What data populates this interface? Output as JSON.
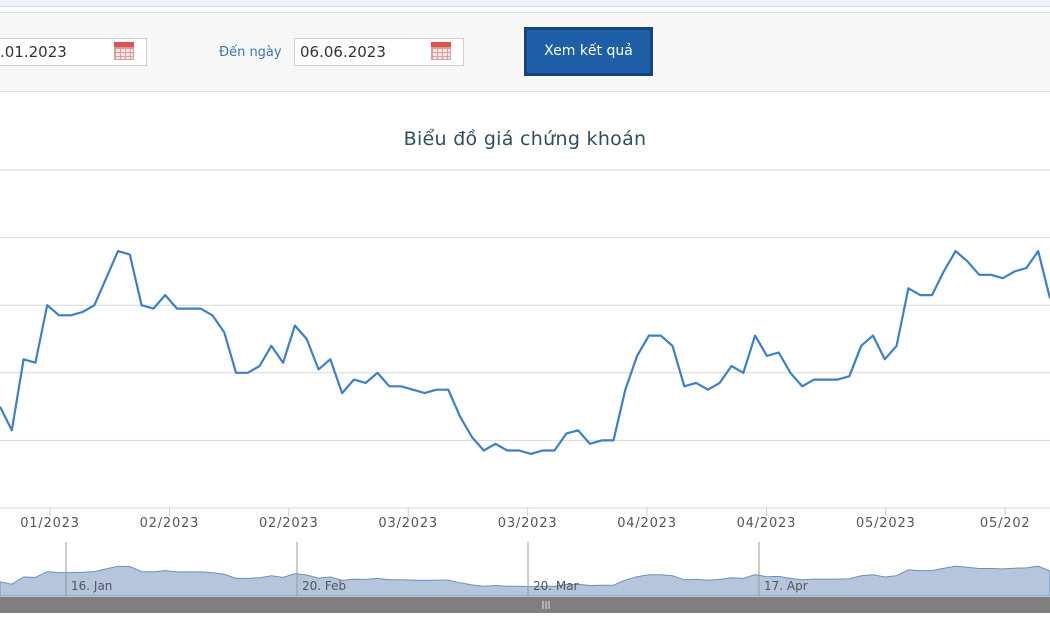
{
  "filters": {
    "from_date": ".01.2023",
    "to_label": "Đến ngày",
    "to_date": "06.06.2023",
    "submit_label": "Xem kết quả"
  },
  "icons": {
    "calendar": "calendar-icon",
    "navigator_handle": "grip-icon"
  },
  "colors": {
    "line": "#3d7fc9",
    "navigator_fill": "#b5c5dc",
    "button": "#1f5fa8",
    "title": "#2f4f5f"
  },
  "chart_data": {
    "type": "line",
    "title": "Biểu đồ giá chứng khoán",
    "xlabel": "",
    "ylabel": "",
    "ylim": [
      0,
      100
    ],
    "grid": true,
    "x_ticks": [
      "01/2023",
      "02/2023",
      "02/2023",
      "03/2023",
      "03/2023",
      "04/2023",
      "04/2023",
      "05/2023",
      "05/202"
    ],
    "navigator_labels": [
      "16. Jan",
      "20. Feb",
      "20. Mar",
      "17. Apr"
    ],
    "series": [
      {
        "values": [
          30,
          23,
          44,
          43,
          60,
          57,
          57,
          58,
          60,
          68,
          76,
          75,
          60,
          59,
          63,
          59,
          59,
          59,
          57,
          52,
          40,
          40,
          42,
          48,
          43,
          54,
          50,
          41,
          44,
          34,
          38,
          37,
          40,
          36,
          36,
          35,
          34,
          35,
          35,
          27,
          21,
          17,
          19,
          17,
          17,
          16,
          17,
          17,
          22,
          23,
          19,
          20,
          20,
          35,
          45,
          51,
          51,
          48,
          36,
          37,
          35,
          37,
          42,
          40,
          51,
          45,
          46,
          40,
          36,
          38,
          38,
          38,
          39,
          48,
          51,
          44,
          48,
          65,
          63,
          63,
          70,
          76,
          73,
          69,
          69,
          68,
          70,
          71,
          76,
          62
        ]
      }
    ]
  }
}
